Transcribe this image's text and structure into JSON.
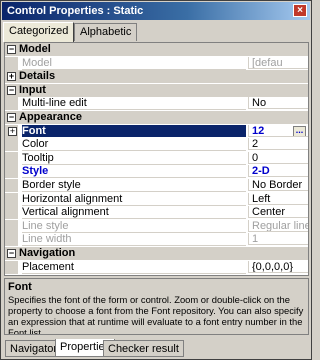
{
  "window": {
    "title": "Control Properties : Static",
    "close_glyph": "×"
  },
  "tabs": [
    {
      "label": "Categorized"
    },
    {
      "label": "Alphabetic"
    }
  ],
  "grid": {
    "rows": [
      {
        "kind": "cat",
        "toggle": "⊟",
        "label": "Model"
      },
      {
        "kind": "prop",
        "label": "Model",
        "value": "[defau",
        "style": "dim"
      },
      {
        "kind": "cat",
        "toggle": "⊞",
        "label": "Details"
      },
      {
        "kind": "cat",
        "toggle": "⊟",
        "label": "Input"
      },
      {
        "kind": "prop",
        "label": "Multi-line edit",
        "value": "No"
      },
      {
        "kind": "cat",
        "toggle": "⊟",
        "label": "Appearance"
      },
      {
        "kind": "prop",
        "label": "Font",
        "value": "12",
        "style": "sel"
      },
      {
        "kind": "prop",
        "label": "Color",
        "value": "2"
      },
      {
        "kind": "prop",
        "label": "Tooltip",
        "value": "0"
      },
      {
        "kind": "prop",
        "label": "Style",
        "value": "2-D",
        "style": "blue"
      },
      {
        "kind": "prop",
        "label": "Border style",
        "value": "No Border"
      },
      {
        "kind": "prop",
        "label": "Horizontal alignment",
        "value": "Left"
      },
      {
        "kind": "prop",
        "label": "Vertical alignment",
        "value": "Center"
      },
      {
        "kind": "prop",
        "label": "Line style",
        "value": "Regular line",
        "style": "dim"
      },
      {
        "kind": "prop",
        "label": "Line width",
        "value": "1",
        "style": "dim"
      },
      {
        "kind": "cat",
        "toggle": "⊟",
        "label": "Navigation"
      },
      {
        "kind": "prop",
        "label": "Placement",
        "value": "{0,0,0,0}"
      }
    ]
  },
  "description": {
    "title": "Font",
    "text": "Specifies the font of the form or control. Zoom or double-click on the property to choose a font from the Font repository. You can also specify an expression that at runtime will evaluate to a font entry number in the Font list."
  },
  "bottom_tabs": [
    {
      "label": "Navigator"
    },
    {
      "label": "Properties"
    },
    {
      "label": "Checker result"
    }
  ]
}
